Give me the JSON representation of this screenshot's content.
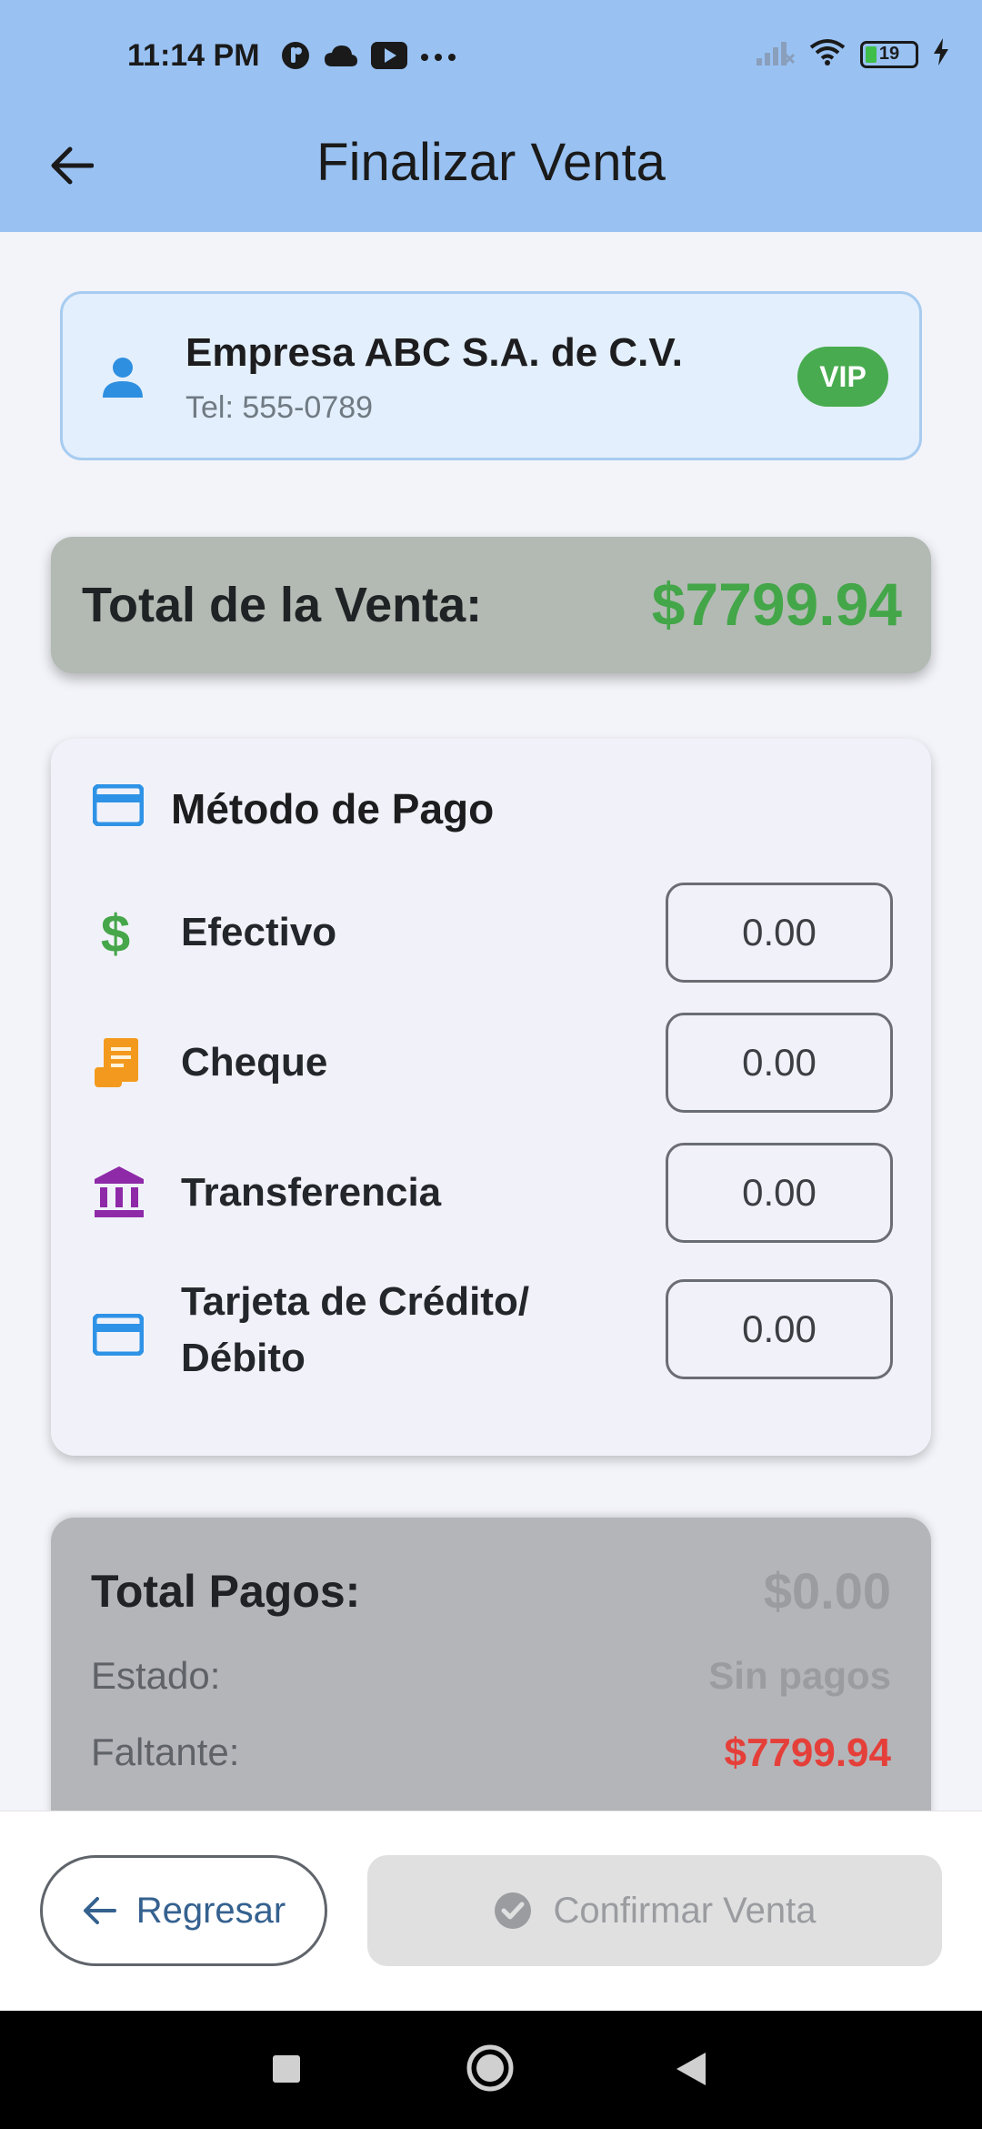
{
  "status_bar": {
    "time": "11:14 PM",
    "battery": "19",
    "icons": [
      "notification-icon",
      "cloud-icon",
      "youtube-icon",
      "more-icon",
      "signal-icon",
      "wifi-icon",
      "battery-icon",
      "charging-icon"
    ]
  },
  "app_bar": {
    "title": "Finalizar Venta",
    "back_icon": "arrow-back-icon"
  },
  "client": {
    "name": "Empresa ABC S.A. de C.V.",
    "phone": "Tel: 555-0789",
    "badge": "VIP"
  },
  "sale_total": {
    "label": "Total de la Venta:",
    "value": "$7799.94"
  },
  "payment_methods": {
    "title": "Método de Pago",
    "items": [
      {
        "label": "Efectivo",
        "value": "0.00",
        "icon": "dollar-icon",
        "color": "#45a64a"
      },
      {
        "label": "Cheque",
        "value": "0.00",
        "icon": "receipt-icon",
        "color": "#f39a1e"
      },
      {
        "label": "Transferencia",
        "value": "0.00",
        "icon": "bank-icon",
        "color": "#8e2aa8"
      },
      {
        "label_line1": "Tarjeta de Crédito/",
        "label_line2": "Débito",
        "value": "0.00",
        "icon": "credit-card-icon",
        "color": "#2e93e6"
      }
    ]
  },
  "summary": {
    "total_label": "Total Pagos:",
    "total_value": "$0.00",
    "status_label": "Estado:",
    "status_value": "Sin pagos",
    "missing_label": "Faltante:",
    "missing_value": "$7799.94"
  },
  "actions": {
    "back_label": "Regresar",
    "confirm_label": "Confirmar Venta"
  },
  "colors": {
    "app_bar": "#99c2f3",
    "accent_green": "#43a648",
    "danger_red": "#e53f3a",
    "primary_blue": "#35618f"
  }
}
